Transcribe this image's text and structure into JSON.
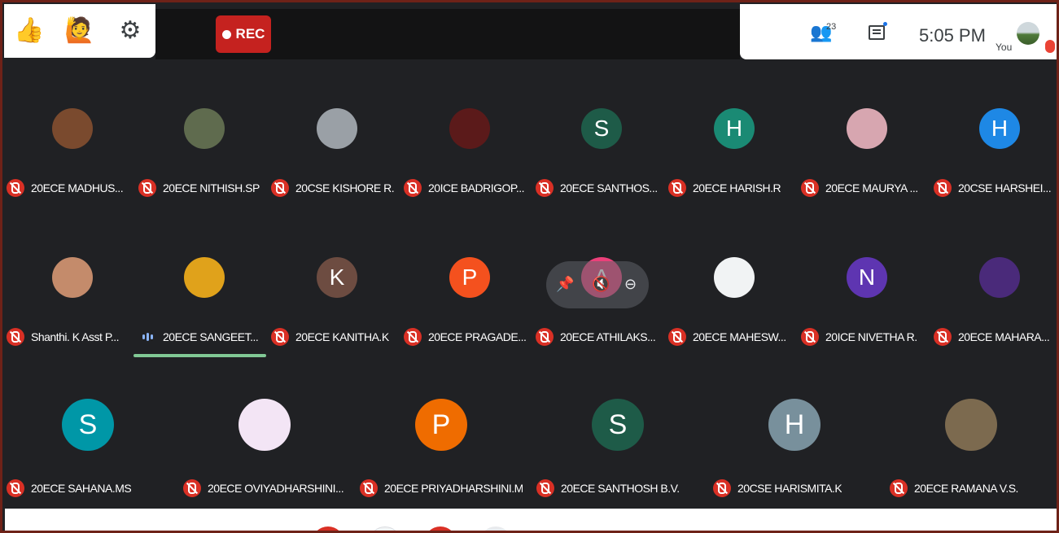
{
  "topbar": {
    "reaction_icon": "thumbs-up-icon",
    "raise_hand_icon": "raise-hand-icon",
    "settings_icon": "gear-icon",
    "rec_label": "REC",
    "participants_count": "23",
    "time": "5:05 PM",
    "self_label": "You"
  },
  "colors": {
    "rec_red": "#c5221f",
    "mic_off_red": "#d93025",
    "speaking_green": "#81c995",
    "tile_bg": "#202124"
  },
  "participants": [
    {
      "name": "20ECE MADHUS...",
      "initial": "",
      "avatar_color": "#7a4a2e",
      "muted": true
    },
    {
      "name": "20ECE NITHISH.SP",
      "initial": "",
      "avatar_color": "#5f6b4e",
      "muted": true
    },
    {
      "name": "20CSE KISHORE R.",
      "initial": "",
      "avatar_color": "#9aa0a6",
      "muted": true
    },
    {
      "name": "20ICE BADRIGOP...",
      "initial": "",
      "avatar_color": "#5b1a1a",
      "muted": true
    },
    {
      "name": "20ECE SANTHOS...",
      "initial": "S",
      "avatar_color": "#1e5b48",
      "muted": true
    },
    {
      "name": "20ECE HARISH.R",
      "initial": "H",
      "avatar_color": "#1a8a74",
      "muted": true
    },
    {
      "name": "20ECE MAURYA ...",
      "initial": "",
      "avatar_color": "#d7a6b0",
      "muted": true
    },
    {
      "name": "20CSE HARSHEI...",
      "initial": "H",
      "avatar_color": "#1e88e5",
      "muted": true
    },
    {
      "name": "Shanthi. K Asst P...",
      "initial": "",
      "avatar_color": "#c48b6b",
      "muted": true
    },
    {
      "name": "20ECE SANGEET...",
      "initial": "",
      "avatar_color": "#e0a21b",
      "muted": false
    },
    {
      "name": "20ECE KANITHA.K",
      "initial": "K",
      "avatar_color": "#6d4c41",
      "muted": true
    },
    {
      "name": "20ECE PRAGADE...",
      "initial": "P",
      "avatar_color": "#f4511e",
      "muted": true
    },
    {
      "name": "20ECE ATHILAKS...",
      "initial": "A",
      "avatar_color": "#ec407a",
      "muted": true
    },
    {
      "name": "20ECE MAHESW...",
      "initial": "",
      "avatar_color": "#f1f3f4",
      "muted": true
    },
    {
      "name": "20ICE NIVETHA R.",
      "initial": "N",
      "avatar_color": "#5e35b1",
      "muted": true
    },
    {
      "name": "20ECE MAHARA...",
      "initial": "",
      "avatar_color": "#4a2a7a",
      "muted": true
    },
    {
      "name": "20ECE SAHANA.MS",
      "initial": "S",
      "avatar_color": "#0097a7",
      "muted": true
    },
    {
      "name": "20ECE OVIYADHARSHINI...",
      "initial": "",
      "avatar_color": "#f3e5f5",
      "muted": true
    },
    {
      "name": "20ECE PRIYADHARSHINI.M",
      "initial": "P",
      "avatar_color": "#ef6c00",
      "muted": true
    },
    {
      "name": "20ECE SANTHOSH B.V.",
      "initial": "S",
      "avatar_color": "#1e5b48",
      "muted": true
    },
    {
      "name": "20CSE HARISMITA.K",
      "initial": "H",
      "avatar_color": "#78909c",
      "muted": true
    },
    {
      "name": "20ECE RAMANA V.S.",
      "initial": "",
      "avatar_color": "#7c6a4f",
      "muted": true
    }
  ]
}
